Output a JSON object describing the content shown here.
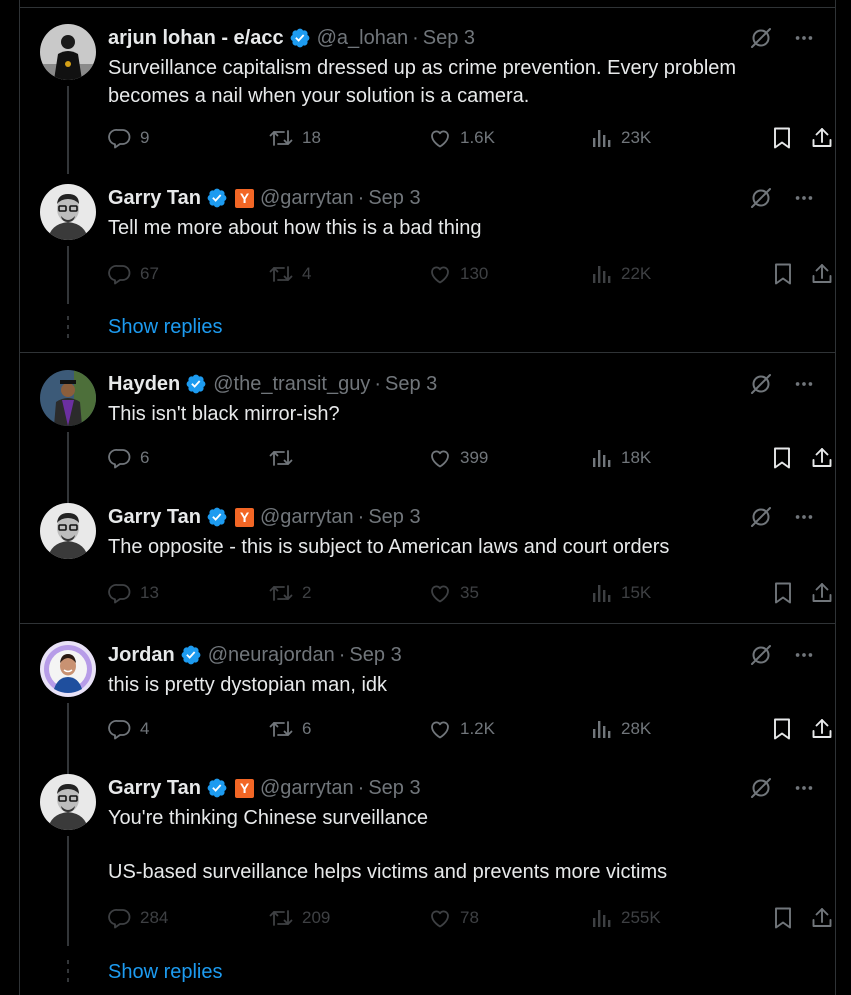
{
  "tweets": [
    {
      "name": "arjun lohan - e/acc",
      "handle": "@a_lohan",
      "date": "Sep 3",
      "text": [
        "Surveillance capitalism dressed up as crime prevention. Every problem becomes a nail when your solution is a camera."
      ],
      "replies": "9",
      "retweets": "18",
      "likes": "1.6K",
      "views": "23K",
      "yc_badge": false
    },
    {
      "name": "Garry Tan",
      "handle": "@garrytan",
      "date": "Sep 3",
      "text": [
        "Tell me more about how this is a bad thing"
      ],
      "replies": "67",
      "retweets": "4",
      "likes": "130",
      "views": "22K",
      "yc_badge": true
    },
    {
      "name": "Hayden",
      "handle": "@the_transit_guy",
      "date": "Sep 3",
      "text": [
        "This isn't black mirror-ish?"
      ],
      "replies": "6",
      "retweets": "",
      "likes": "399",
      "views": "18K",
      "yc_badge": false
    },
    {
      "name": "Garry Tan",
      "handle": "@garrytan",
      "date": "Sep 3",
      "text": [
        "The opposite - this is subject to American laws and court orders"
      ],
      "replies": "13",
      "retweets": "2",
      "likes": "35",
      "views": "15K",
      "yc_badge": true
    },
    {
      "name": "Jordan",
      "handle": "@neurajordan",
      "date": "Sep 3",
      "text": [
        "this is pretty dystopian man, idk"
      ],
      "replies": "4",
      "retweets": "6",
      "likes": "1.2K",
      "views": "28K",
      "yc_badge": false
    },
    {
      "name": "Garry Tan",
      "handle": "@garrytan",
      "date": "Sep 3",
      "text": [
        "You're thinking Chinese surveillance",
        "US-based surveillance helps victims and prevents more victims"
      ],
      "replies": "284",
      "retweets": "209",
      "likes": "78",
      "views": "255K",
      "yc_badge": true
    }
  ],
  "show_replies_label": "Show replies",
  "yc_letter": "Y",
  "colors": {
    "background": "#000000",
    "text": "#e7e9ea",
    "muted": "#71767b",
    "accent": "#1d9bf0",
    "verified": "#1d9bf0",
    "yc": "#f26625",
    "border": "#2f3336"
  },
  "icons": [
    "verified-badge-icon",
    "grok-icon",
    "more-icon",
    "reply-icon",
    "retweet-icon",
    "like-icon",
    "views-icon",
    "bookmark-icon",
    "share-icon"
  ]
}
